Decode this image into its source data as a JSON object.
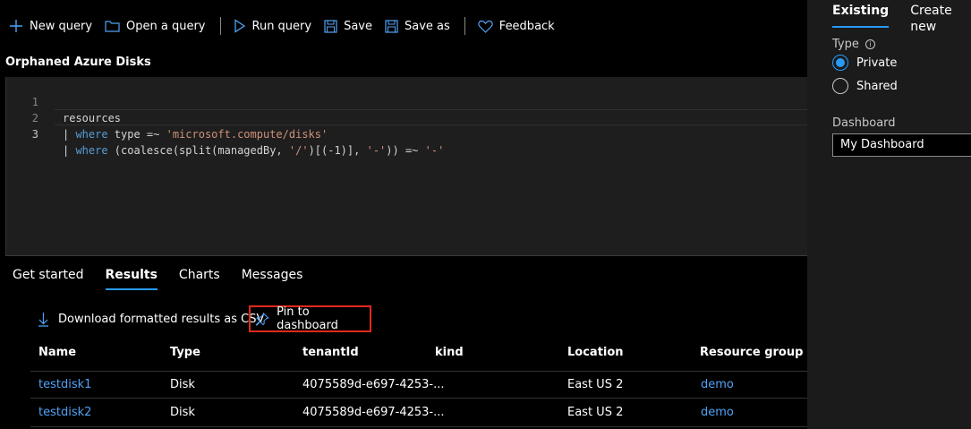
{
  "toolbar": {
    "new_query": "New query",
    "open_query": "Open a query",
    "run_query": "Run query",
    "save": "Save",
    "save_as": "Save as",
    "feedback": "Feedback"
  },
  "query_title": "Orphaned Azure Disks",
  "editor": {
    "line_numbers": [
      "1",
      "2",
      "3"
    ],
    "line1": "resources",
    "line2": {
      "pipe": "| ",
      "kw": "where",
      "mid": " type =~ ",
      "str": "'microsoft.compute/disks'"
    },
    "line3": {
      "pipe": "| ",
      "kw": "where",
      "mid": " (coalesce(split(managedBy, ",
      "str1": "'/'",
      "mid2": ")[(-1)], ",
      "str2": "'-'",
      "mid3": ")) =~ ",
      "str3": "'-'"
    }
  },
  "tabs": [
    "Get started",
    "Results",
    "Charts",
    "Messages"
  ],
  "actions": {
    "download": "Download formatted results as CSV",
    "pin": "Pin to dashboard"
  },
  "table": {
    "columns": [
      "Name",
      "Type",
      "tenantId",
      "kind",
      "Location",
      "Resource group"
    ],
    "rows": [
      {
        "name": "testdisk1",
        "type": "Disk",
        "tenantId": "4075589d-e697-4253-...",
        "kind": "",
        "location": "East US 2",
        "group": "demo"
      },
      {
        "name": "testdisk2",
        "type": "Disk",
        "tenantId": "4075589d-e697-4253-...",
        "kind": "",
        "location": "East US 2",
        "group": "demo"
      }
    ]
  },
  "panel": {
    "tabs": [
      "Existing",
      "Create new"
    ],
    "type_label": "Type",
    "options": [
      "Private",
      "Shared"
    ],
    "selected_option": "Private",
    "dashboard_label": "Dashboard",
    "dashboard_value": "My Dashboard"
  },
  "colors": {
    "accent": "#2899f5",
    "highlight_border": "#e0291a",
    "link": "#4fa3f7"
  }
}
